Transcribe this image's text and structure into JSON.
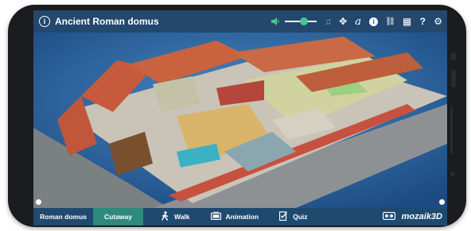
{
  "app": {
    "title": "Ancient Roman domus",
    "title_icon": "info-circle-icon"
  },
  "toolbar": {
    "icons": [
      "speaker-icon",
      "volume-slider",
      "music-note-icon",
      "move-arrows-icon",
      "text-a-icon",
      "info-icon",
      "link-icon",
      "grid-icon",
      "help-icon",
      "gear-icon"
    ],
    "music_glyph": "♫",
    "move_glyph": "✥",
    "text_glyph": "a",
    "info_glyph": "i",
    "link_glyph": "⛓",
    "grid_glyph": "▦",
    "help_glyph": "?",
    "gear_glyph": "⚙",
    "volume_level": 0.62
  },
  "colors": {
    "accent": "#44c98a",
    "topbar": "#23476d",
    "active_tab": "#2d8a7c"
  },
  "tabs": [
    {
      "label": "Roman domus",
      "active": false
    },
    {
      "label": "Cutaway",
      "active": true
    },
    {
      "label": "Walk",
      "icon": "walk-icon",
      "active": false
    },
    {
      "label": "Animation",
      "icon": "animation-icon",
      "active": false
    },
    {
      "label": "Quiz",
      "icon": "quiz-icon",
      "active": false
    }
  ],
  "brand": {
    "name": "mozaik3D",
    "vr_icon": "vr-goggles-icon"
  }
}
